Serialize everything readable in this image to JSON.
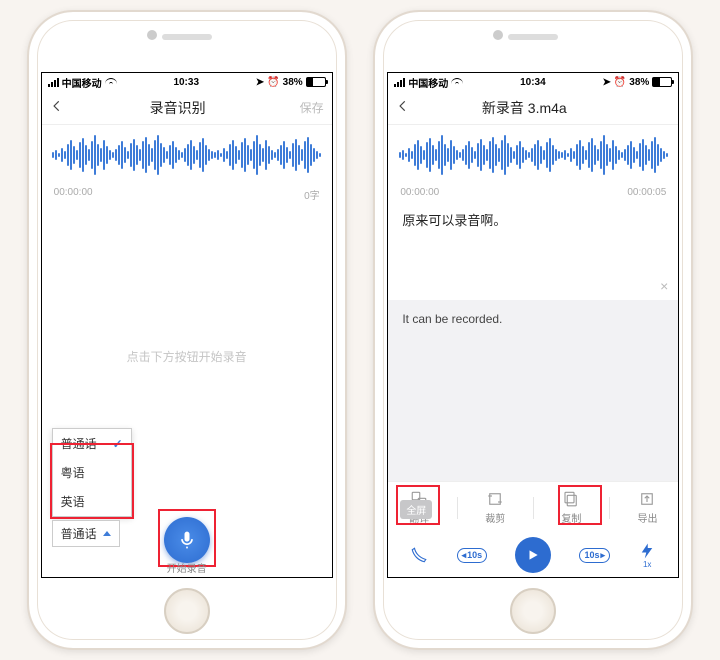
{
  "left": {
    "status": {
      "carrier": "中国移动",
      "time": "10:33",
      "battery": "38%"
    },
    "nav": {
      "title": "录音识别",
      "save_label": "保存"
    },
    "times": {
      "left": "00:00:00",
      "right": "0字"
    },
    "placeholder": "点击下方按钮开始录音",
    "lang_menu": {
      "items": [
        {
          "label": "普通话",
          "selected": true
        },
        {
          "label": "粤语",
          "selected": false
        },
        {
          "label": "英语",
          "selected": false
        }
      ]
    },
    "lang_dd": {
      "label": "普通话"
    },
    "mic_label": "开始录音"
  },
  "right": {
    "status": {
      "carrier": "中国移动",
      "time": "10:34",
      "battery": "38%"
    },
    "nav": {
      "title": "新录音 3.m4a"
    },
    "times": {
      "left": "00:00:00",
      "right": "00:00:05"
    },
    "transcript": "原来可以录音啊。",
    "translation": "It can be recorded.",
    "fullscreen": "全屏",
    "toolbar": {
      "translate": "翻译",
      "crop": "裁剪",
      "copy": "复制",
      "export": "导出"
    },
    "skip_back": "10s",
    "skip_fwd": "10s",
    "speed": "1x"
  }
}
